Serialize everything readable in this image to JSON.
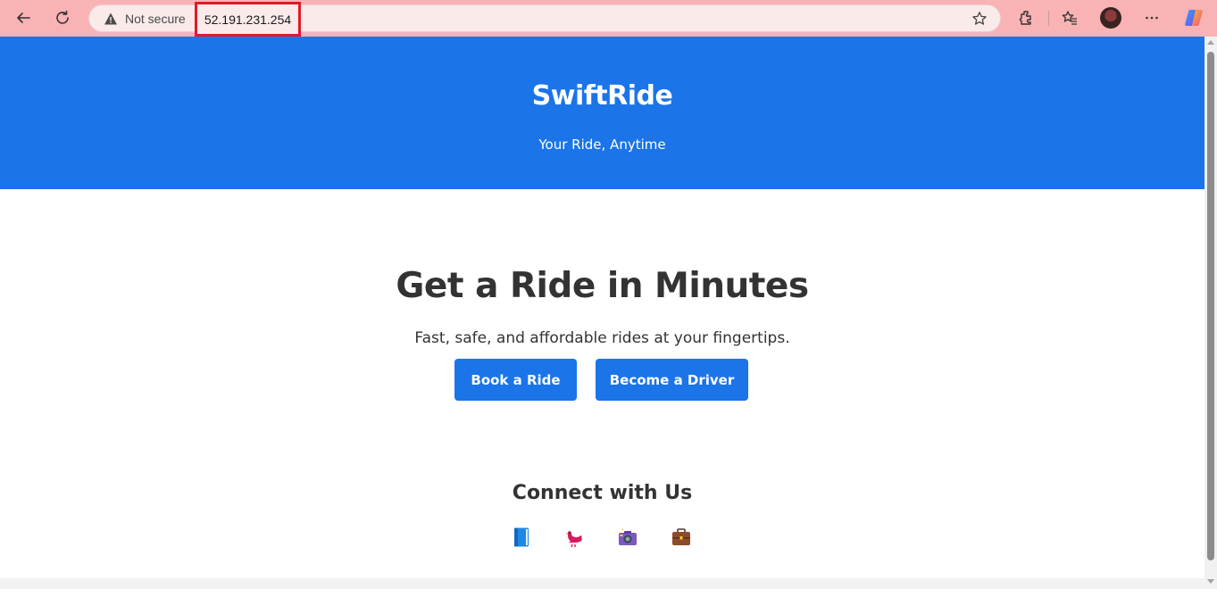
{
  "browser": {
    "security_label": "Not secure",
    "url": "52.191.231.254",
    "chrome_color": "#f9b3b5",
    "highlight_color": "#e01b24",
    "icons": [
      "back-icon",
      "refresh-icon",
      "warning-icon",
      "favorite-star-icon",
      "extensions-icon",
      "favorites-icon",
      "profile-avatar",
      "more-icon",
      "copilot-icon"
    ]
  },
  "header": {
    "title": "SwiftRide",
    "tagline": "Your Ride, Anytime",
    "background": "#1b74e8"
  },
  "hero": {
    "heading": "Get a Ride in Minutes",
    "subheading": "Fast, safe, and affordable rides at your fingertips.",
    "buttons": [
      {
        "label": "Book a Ride"
      },
      {
        "label": "Become a Driver"
      }
    ]
  },
  "connect": {
    "heading": "Connect with Us",
    "social_icons": [
      "book-icon",
      "bird-icon",
      "camera-icon",
      "briefcase-icon"
    ]
  }
}
